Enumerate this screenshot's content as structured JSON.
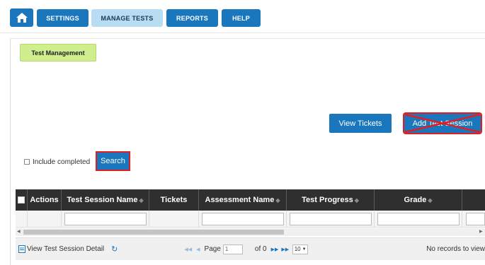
{
  "nav": {
    "settings": "SETTINGS",
    "manage_tests": "MANAGE TESTS",
    "reports": "REPORTS",
    "help": "HELP"
  },
  "tab": {
    "label": "Test Management"
  },
  "actions": {
    "view_tickets": "View Tickets",
    "add_session": "Add Test Session"
  },
  "filter": {
    "include_completed": "Include completed",
    "search": "Search"
  },
  "grid": {
    "columns": [
      "Actions",
      "Test Session Name",
      "Tickets",
      "Assessment Name",
      "Test Progress",
      "Grade"
    ]
  },
  "pager": {
    "view_detail": "View Test Session Detail",
    "page_label": "Page",
    "page_value": "1",
    "of_label": "of 0",
    "page_size": "10",
    "no_records": "No records to view"
  },
  "colors": {
    "accent": "#1a76bd",
    "tab": "#cfee8e",
    "highlight": "#e02020",
    "grid_header": "#2f2f2f"
  }
}
